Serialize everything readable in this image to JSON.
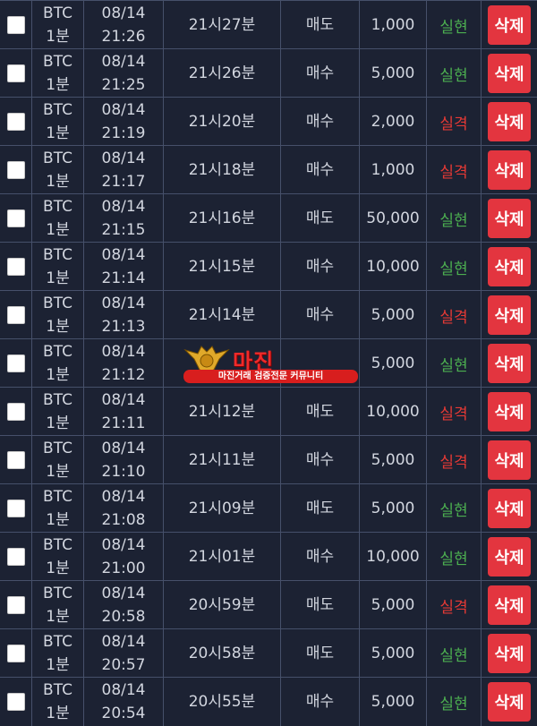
{
  "colors": {
    "background": "#1c2233",
    "grid": "#46506a",
    "text": "#d2d6df",
    "win": "#4caf50",
    "loss": "#e53935",
    "delete_button": "#e3353f"
  },
  "rows": [
    {
      "coin": "BTC",
      "interval": "1분",
      "date": "08/14",
      "time": "21:26",
      "round": "21시27분",
      "side": "매도",
      "amount": "1,000",
      "result": "실현",
      "result_status": "win",
      "delete_label": "삭제"
    },
    {
      "coin": "BTC",
      "interval": "1분",
      "date": "08/14",
      "time": "21:25",
      "round": "21시26분",
      "side": "매수",
      "amount": "5,000",
      "result": "실현",
      "result_status": "win",
      "delete_label": "삭제"
    },
    {
      "coin": "BTC",
      "interval": "1분",
      "date": "08/14",
      "time": "21:19",
      "round": "21시20분",
      "side": "매수",
      "amount": "2,000",
      "result": "실격",
      "result_status": "loss",
      "delete_label": "삭제"
    },
    {
      "coin": "BTC",
      "interval": "1분",
      "date": "08/14",
      "time": "21:17",
      "round": "21시18분",
      "side": "매수",
      "amount": "1,000",
      "result": "실격",
      "result_status": "loss",
      "delete_label": "삭제"
    },
    {
      "coin": "BTC",
      "interval": "1분",
      "date": "08/14",
      "time": "21:15",
      "round": "21시16분",
      "side": "매도",
      "amount": "50,000",
      "result": "실현",
      "result_status": "win",
      "delete_label": "삭제"
    },
    {
      "coin": "BTC",
      "interval": "1분",
      "date": "08/14",
      "time": "21:14",
      "round": "21시15분",
      "side": "매수",
      "amount": "10,000",
      "result": "실현",
      "result_status": "win",
      "delete_label": "삭제"
    },
    {
      "coin": "BTC",
      "interval": "1분",
      "date": "08/14",
      "time": "21:13",
      "round": "21시14분",
      "side": "매수",
      "amount": "5,000",
      "result": "실격",
      "result_status": "loss",
      "delete_label": "삭제"
    },
    {
      "coin": "BTC",
      "interval": "1분",
      "date": "08/14",
      "time": "21:12",
      "round": "",
      "side": "",
      "amount": "5,000",
      "result": "실현",
      "result_status": "win",
      "delete_label": "삭제"
    },
    {
      "coin": "BTC",
      "interval": "1분",
      "date": "08/14",
      "time": "21:11",
      "round": "21시12분",
      "side": "매도",
      "amount": "10,000",
      "result": "실격",
      "result_status": "loss",
      "delete_label": "삭제"
    },
    {
      "coin": "BTC",
      "interval": "1분",
      "date": "08/14",
      "time": "21:10",
      "round": "21시11분",
      "side": "매수",
      "amount": "5,000",
      "result": "실격",
      "result_status": "loss",
      "delete_label": "삭제"
    },
    {
      "coin": "BTC",
      "interval": "1분",
      "date": "08/14",
      "time": "21:08",
      "round": "21시09분",
      "side": "매도",
      "amount": "5,000",
      "result": "실현",
      "result_status": "win",
      "delete_label": "삭제"
    },
    {
      "coin": "BTC",
      "interval": "1분",
      "date": "08/14",
      "time": "21:00",
      "round": "21시01분",
      "side": "매수",
      "amount": "10,000",
      "result": "실현",
      "result_status": "win",
      "delete_label": "삭제"
    },
    {
      "coin": "BTC",
      "interval": "1분",
      "date": "08/14",
      "time": "20:58",
      "round": "20시59분",
      "side": "매도",
      "amount": "5,000",
      "result": "실격",
      "result_status": "loss",
      "delete_label": "삭제"
    },
    {
      "coin": "BTC",
      "interval": "1분",
      "date": "08/14",
      "time": "20:57",
      "round": "20시58분",
      "side": "매도",
      "amount": "5,000",
      "result": "실현",
      "result_status": "win",
      "delete_label": "삭제"
    },
    {
      "coin": "BTC",
      "interval": "1분",
      "date": "08/14",
      "time": "20:54",
      "round": "20시55분",
      "side": "매수",
      "amount": "5,000",
      "result": "실현",
      "result_status": "win",
      "delete_label": "삭제"
    }
  ],
  "watermark": {
    "title": "마진",
    "subtitle": "마진거래 검증전문 커뮤니티"
  }
}
